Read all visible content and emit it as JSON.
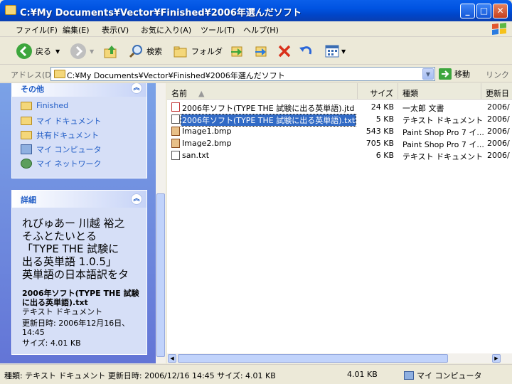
{
  "window": {
    "title": "C:¥My Documents¥Vector¥Finished¥2006年選んだソフト"
  },
  "menu": [
    "ファイル(F)",
    "編集(E)",
    "表示(V)",
    "お気に入り(A)",
    "ツール(T)",
    "ヘルプ(H)"
  ],
  "toolbar": {
    "back": "戻る",
    "search": "検索",
    "folders": "フォルダ"
  },
  "address": {
    "label": "アドレス(D)",
    "value": "C:¥My Documents¥Vector¥Finished¥2006年選んだソフト",
    "go": "移動",
    "links": "リンク"
  },
  "sidepane": {
    "other_title": "その他",
    "other_items": [
      "Finished",
      "マイ ドキュメント",
      "共有ドキュメント",
      "マイ コンピュータ",
      "マイ ネットワーク"
    ],
    "details_title": "詳細",
    "details_name": "れびゅあー 川越 裕之 そふとたいとる 「TYPE THE 試験に出る英単語 1.0.5」 英単語の日本語訳をタ",
    "details_file": "2006年ソフト(TYPE THE 試験に出る英単語).txt",
    "details_type": "テキスト ドキュメント",
    "details_date": "更新日時: 2006年12月16日、14:45",
    "details_size": "サイズ: 4.01 KB"
  },
  "columns": {
    "name": "名前",
    "size": "サイズ",
    "type": "種類",
    "date": "更新日"
  },
  "files": [
    {
      "name": "2006年ソフト(TYPE THE 試験に出る英単語).jtd",
      "size": "24 KB",
      "type": "一太郎 文書",
      "date": "2006/"
    },
    {
      "name": "2006年ソフト(TYPE THE 試験に出る英単語).txt",
      "size": "5 KB",
      "type": "テキスト ドキュメント",
      "date": "2006/"
    },
    {
      "name": "Image1.bmp",
      "size": "543 KB",
      "type": "Paint Shop Pro 7 イ...",
      "date": "2006/"
    },
    {
      "name": "Image2.bmp",
      "size": "705 KB",
      "type": "Paint Shop Pro 7 イ...",
      "date": "2006/"
    },
    {
      "name": "san.txt",
      "size": "6 KB",
      "type": "テキスト ドキュメント",
      "date": "2006/"
    }
  ],
  "status": {
    "info": "種類: テキスト ドキュメント 更新日時: 2006/12/16 14:45 サイズ: 4.01 KB",
    "size": "4.01 KB",
    "location": "マイ コンピュータ"
  }
}
